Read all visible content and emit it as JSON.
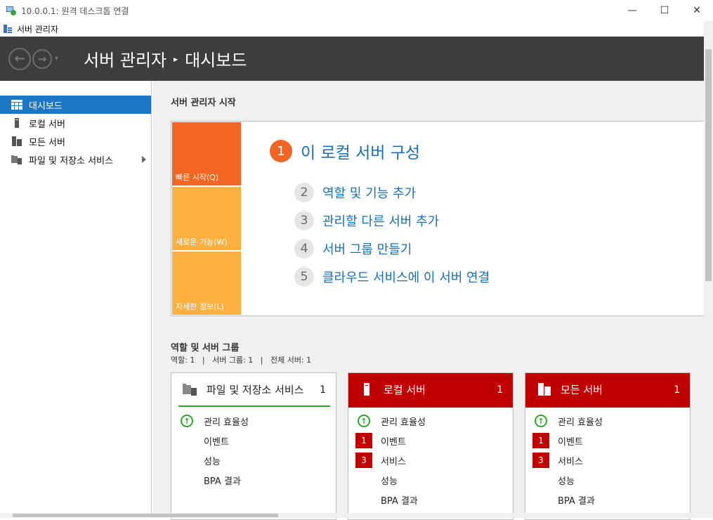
{
  "rdp_window": {
    "title": "10.0.0.1: 원격 데스크톱 연결",
    "minimize": "—",
    "maximize": "☐",
    "close": "✕"
  },
  "app_window": {
    "title": "서버 관리자"
  },
  "header": {
    "breadcrumb_root": "서버 관리자",
    "breadcrumb_sep": "▸",
    "breadcrumb_current": "대시보드",
    "back_glyph": "←",
    "forward_glyph": "→",
    "dropdown_glyph": "▾"
  },
  "sidebar": {
    "items": [
      {
        "label": "대시보드",
        "icon": "dashboard-icon",
        "active": true
      },
      {
        "label": "로컬 서버",
        "icon": "local-server-icon"
      },
      {
        "label": "모든 서버",
        "icon": "all-servers-icon"
      },
      {
        "label": "파일 및 저장소 서비스",
        "icon": "file-storage-icon",
        "has_arrow": true
      }
    ]
  },
  "welcome": {
    "title": "서버 관리자 시작",
    "tiles": [
      "빠른 시작(Q)",
      "새로운 기능(W)",
      "자세한 정보(L)"
    ],
    "step1": {
      "num": "1",
      "text": "이 로컬 서버 구성"
    },
    "steps": [
      {
        "num": "2",
        "text": "역할 및 기능 추가"
      },
      {
        "num": "3",
        "text": "관리할 다른 서버 추가"
      },
      {
        "num": "4",
        "text": "서버 그룹 만들기"
      },
      {
        "num": "5",
        "text": "클라우드 서비스에 이 서버 연결"
      }
    ]
  },
  "roles": {
    "title": "역할 및 서버 그룹",
    "counts": "역할: 1   |   서버 그룹: 1   |   전체 서버: 1",
    "cards": [
      {
        "title": "파일 및 저장소 서비스",
        "count": "1",
        "rows": [
          {
            "label": "관리 효율성",
            "status": "ok"
          },
          {
            "label": "이벤트"
          },
          {
            "label": "성능"
          },
          {
            "label": "BPA 결과"
          }
        ]
      },
      {
        "title": "로컬 서버",
        "count": "1",
        "rows": [
          {
            "label": "관리 효율성",
            "status": "ok"
          },
          {
            "label": "이벤트",
            "badge": "1"
          },
          {
            "label": "서비스",
            "badge": "3"
          },
          {
            "label": "성능"
          },
          {
            "label": "BPA 결과"
          }
        ]
      },
      {
        "title": "모든 서버",
        "count": "1",
        "rows": [
          {
            "label": "관리 효율성",
            "status": "ok"
          },
          {
            "label": "이벤트",
            "badge": "1"
          },
          {
            "label": "서비스",
            "badge": "3"
          },
          {
            "label": "성능"
          },
          {
            "label": "BPA 결과"
          }
        ]
      }
    ]
  },
  "colors": {
    "header_bg": "#3d3d3d",
    "active_nav": "#1c78c5",
    "quick_start": "#f26522",
    "tile_yellow": "#fcb040",
    "alert_red": "#c00000",
    "ok_green": "#2ba82b",
    "link_blue": "#1a6fb0"
  }
}
